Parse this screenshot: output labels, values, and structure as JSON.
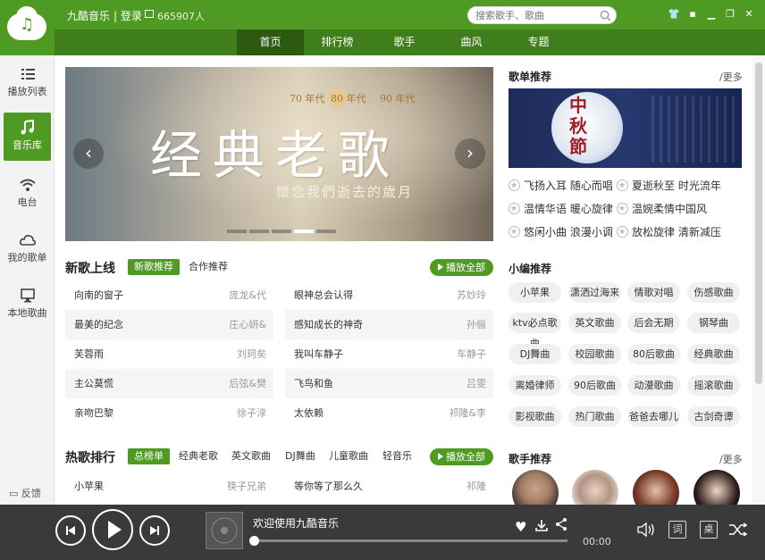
{
  "titlebar": {
    "app_name": "九酷音乐",
    "login": "| 登录",
    "online_count": "665907人",
    "search_placeholder": "搜索歌手、歌曲"
  },
  "nav": [
    "首页",
    "排行榜",
    "歌手",
    "曲风",
    "专题"
  ],
  "sidebar": [
    {
      "label": "播放列表",
      "icon": "list-icon"
    },
    {
      "label": "音乐库",
      "icon": "music-note-icon"
    },
    {
      "label": "电台",
      "icon": "wifi-icon"
    },
    {
      "label": "我的歌单",
      "icon": "cloud-icon"
    },
    {
      "label": "本地歌曲",
      "icon": "monitor-icon"
    }
  ],
  "feedback": "反馈",
  "banner": {
    "title": "经典老歌",
    "subtitle": "懷念我們逝去的歲月",
    "eras": [
      "70 年代",
      "80 年代",
      "90 年代"
    ]
  },
  "new_songs": {
    "title": "新歌上线",
    "tabs": [
      "新歌推荐",
      "合作推荐"
    ],
    "play_all": "播放全部",
    "left": [
      {
        "title": "向南的窗子",
        "artist": "庞龙&代"
      },
      {
        "title": "最美的纪念",
        "artist": "庄心妍&"
      },
      {
        "title": "芙蓉雨",
        "artist": "刘珂矣"
      },
      {
        "title": "主公莫慌",
        "artist": "后弦&樊"
      },
      {
        "title": "亲吻巴黎",
        "artist": "徐子淳"
      }
    ],
    "right": [
      {
        "title": "眼神总会认得",
        "artist": "苏妙玲"
      },
      {
        "title": "感知成长的神奇",
        "artist": "孙俪"
      },
      {
        "title": "我叫车静子",
        "artist": "车静子"
      },
      {
        "title": "飞鸟和鱼",
        "artist": "吕雯"
      },
      {
        "title": "太依赖",
        "artist": "祁隆&李"
      }
    ]
  },
  "hot_songs": {
    "title": "热歌排行",
    "tabs": [
      "总榜单",
      "经典老歌",
      "英文歌曲",
      "DJ舞曲",
      "儿童歌曲",
      "轻音乐"
    ],
    "play_all": "播放全部",
    "left": [
      {
        "title": "小苹果",
        "artist": "筷子兄弟"
      }
    ],
    "right": [
      {
        "title": "等你等了那么久",
        "artist": "祁隆"
      }
    ]
  },
  "playlist_rec": {
    "title": "歌单推荐",
    "more": "/更多",
    "image_text": "中秋節",
    "items": [
      "飞扬入耳 随心而唱",
      "夏逝秋至 时光流年",
      "温情华语 暖心旋律",
      "温婉柔情中国风",
      "悠闲小曲 浪漫小调",
      "放松旋律 清新减压"
    ]
  },
  "editor_rec": {
    "title": "小编推荐",
    "tags": [
      "小苹果",
      "潇洒过海来",
      "情歌对唱",
      "伤感歌曲",
      "ktv必点歌曲",
      "英文歌曲",
      "后会无期",
      "钢琴曲",
      "DJ舞曲",
      "校园歌曲",
      "80后歌曲",
      "经典歌曲",
      "离婚律师",
      "90后歌曲",
      "动漫歌曲",
      "摇滚歌曲",
      "影视歌曲",
      "热门歌曲",
      "爸爸去哪儿",
      "古剑奇谭"
    ]
  },
  "singer_rec": {
    "title": "歌手推荐",
    "more": "/更多"
  },
  "player": {
    "now_playing": "欢迎使用九酷音乐",
    "time": "00:00",
    "lyrics_btn": "词",
    "desktop_btn": "桌",
    "progress": 0
  }
}
